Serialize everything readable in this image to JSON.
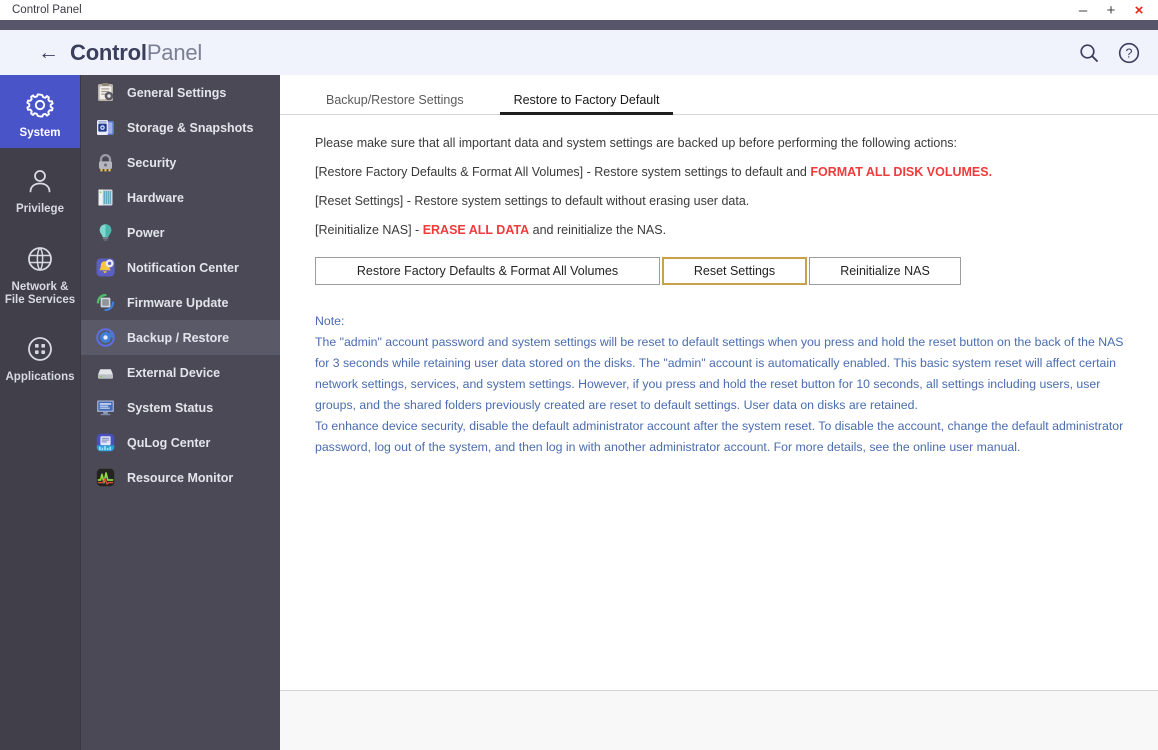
{
  "window": {
    "title": "Control Panel",
    "controls": [
      {
        "name": "minimize",
        "glyph": "–"
      },
      {
        "name": "maximize",
        "glyph": "+"
      },
      {
        "name": "close",
        "glyph": "×"
      }
    ]
  },
  "header": {
    "back_glyph": "←",
    "title_bold": "Control",
    "title_light": "Panel",
    "icons": [
      {
        "name": "search-icon",
        "label": "Search"
      },
      {
        "name": "help-icon",
        "label": "Help"
      }
    ]
  },
  "rail": {
    "items": [
      {
        "id": "system",
        "label": "System",
        "icon": "gear-icon",
        "active": true
      },
      {
        "id": "privilege",
        "label": "Privilege",
        "icon": "user-icon",
        "active": false
      },
      {
        "id": "network",
        "label": "Network &\nFile Services",
        "icon": "globe-icon",
        "active": false
      },
      {
        "id": "apps",
        "label": "Applications",
        "icon": "grid-icon",
        "active": false
      }
    ]
  },
  "menu": {
    "items": [
      {
        "label": "General Settings",
        "icon": "clipboard-gear-icon",
        "active": false
      },
      {
        "label": "Storage & Snapshots",
        "icon": "storage-icon",
        "active": false
      },
      {
        "label": "Security",
        "icon": "lock-icon",
        "active": false
      },
      {
        "label": "Hardware",
        "icon": "hardware-icon",
        "active": false
      },
      {
        "label": "Power",
        "icon": "bulb-icon",
        "active": false
      },
      {
        "label": "Notification Center",
        "icon": "bell-gear-icon",
        "active": false
      },
      {
        "label": "Firmware Update",
        "icon": "firmware-icon",
        "active": false
      },
      {
        "label": "Backup / Restore",
        "icon": "backup-restore-icon",
        "active": true
      },
      {
        "label": "External Device",
        "icon": "external-drive-icon",
        "active": false
      },
      {
        "label": "System Status",
        "icon": "monitor-icon",
        "active": false
      },
      {
        "label": "QuLog Center",
        "icon": "qulog-icon",
        "active": false
      },
      {
        "label": "Resource Monitor",
        "icon": "resource-monitor-icon",
        "active": false
      }
    ]
  },
  "main": {
    "tabs": [
      {
        "label": "Backup/Restore Settings",
        "active": false
      },
      {
        "label": "Restore to Factory Default",
        "active": true
      }
    ],
    "paragraphs": {
      "p1": "Please make sure that all important data and system settings are backed up before performing the following actions:",
      "p2_pre": "[Restore Factory Defaults & Format All Volumes] - Restore system settings to default and ",
      "p2_red": "FORMAT ALL DISK VOLUMES.",
      "p3": "[Reset Settings] - Restore system settings to default without erasing user data.",
      "p4_pre": "[Reinitialize NAS] - ",
      "p4_red": "ERASE ALL DATA",
      "p4_post": " and reinitialize the NAS."
    },
    "buttons": {
      "restore_factory": "Restore Factory Defaults & Format All Volumes",
      "reset_settings": "Reset Settings",
      "reinitialize_nas": "Reinitialize NAS",
      "focused": "reset_settings",
      "focus_color": "#c8a14c"
    },
    "note": {
      "heading": "Note:",
      "lines": [
        "The \"admin\" account password and system settings will be reset to default settings when you press and hold the reset button on the back of the NAS",
        "for 3 seconds while retaining user data stored on the disks. The \"admin\" account is automatically enabled. This basic system reset will affect certain",
        "network settings, services, and system settings. However, if you press and hold the reset button for 10 seconds, all settings including users, user",
        "groups, and the shared folders previously created are reset to default settings. User data on disks are retained.",
        "To enhance device security, disable the default administrator account after the system reset. To disable the account, change the default administrator",
        "password, log out of the system, and then log in with another administrator account. For more details, see the online user manual."
      ]
    }
  },
  "colors": {
    "rail_bg": "#403f4a",
    "menu_bg": "#4a4955",
    "menu_active": "#5a5967",
    "rail_active": "#4a54c9",
    "header_bg": "#f0f3fc",
    "band": "#565569",
    "note_text": "#4a6cb0",
    "danger": "#ef3b3b",
    "close": "#e8251f"
  }
}
